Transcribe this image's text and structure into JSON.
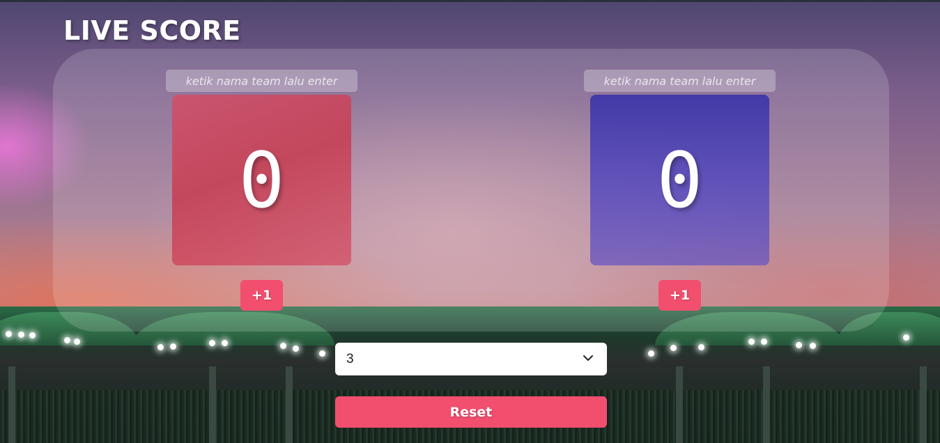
{
  "header": {
    "title": "LIVE SCORE"
  },
  "teams": [
    {
      "name_placeholder": "ketik nama team lalu enter",
      "score": "0",
      "increment_label": "+1",
      "color": "#d2506a"
    },
    {
      "name_placeholder": "ketik nama team lalu enter",
      "score": "0",
      "increment_label": "+1",
      "color": "#4e44b4"
    }
  ],
  "controls": {
    "round_select_value": "3",
    "reset_label": "Reset"
  },
  "colors": {
    "accent": "#f24e6e",
    "panel": "rgba(255,255,255,0.16)"
  }
}
